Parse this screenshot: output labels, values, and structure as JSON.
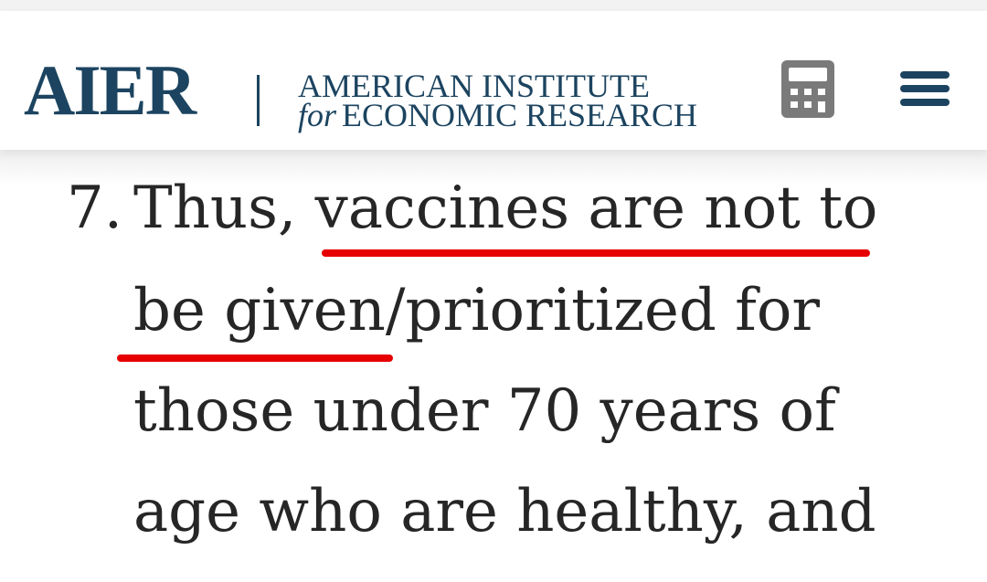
{
  "header": {
    "logo": "AIER",
    "org_line1": "AMERICAN INSTITUTE",
    "org_line2_prefix": "for",
    "org_line2": "ECONOMIC RESEARCH",
    "calculator_icon": "calculator-icon",
    "menu_icon": "hamburger-menu-icon"
  },
  "article": {
    "list_number": "7.",
    "line1_prefix": "Thus, ",
    "line1_highlight": "vaccines are not to",
    "line2_highlight": "be given",
    "line2_rest": "/prioritized for",
    "line3": "those under 70 years of",
    "line4": "age who are healthy, and"
  },
  "colors": {
    "brand": "#1c4460",
    "highlight_underline": "#e60000",
    "text": "#262626",
    "icon_gray": "#7a7a7a"
  }
}
